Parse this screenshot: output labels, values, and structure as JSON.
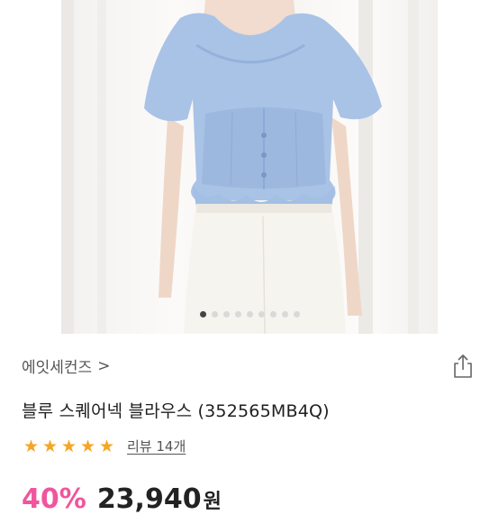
{
  "gallery": {
    "image_alt": "model wearing blue square-neck puff sleeve blouse with white skirt",
    "slide_count": 9,
    "active_index": 0
  },
  "product": {
    "brand": "에잇세컨즈",
    "brand_chevron": ">",
    "title": "블루 스퀘어넥 블라우스 (352565MB4Q)",
    "rating": 5,
    "review_text": "리뷰 14개"
  },
  "pricing": {
    "discount": "40%",
    "price": "23,940",
    "currency": "원"
  },
  "colors": {
    "star": "#f5a623",
    "discount": "#f0559d",
    "text": "#1f1f1f"
  },
  "icons": {
    "share": "share-icon",
    "star": "star-icon"
  }
}
